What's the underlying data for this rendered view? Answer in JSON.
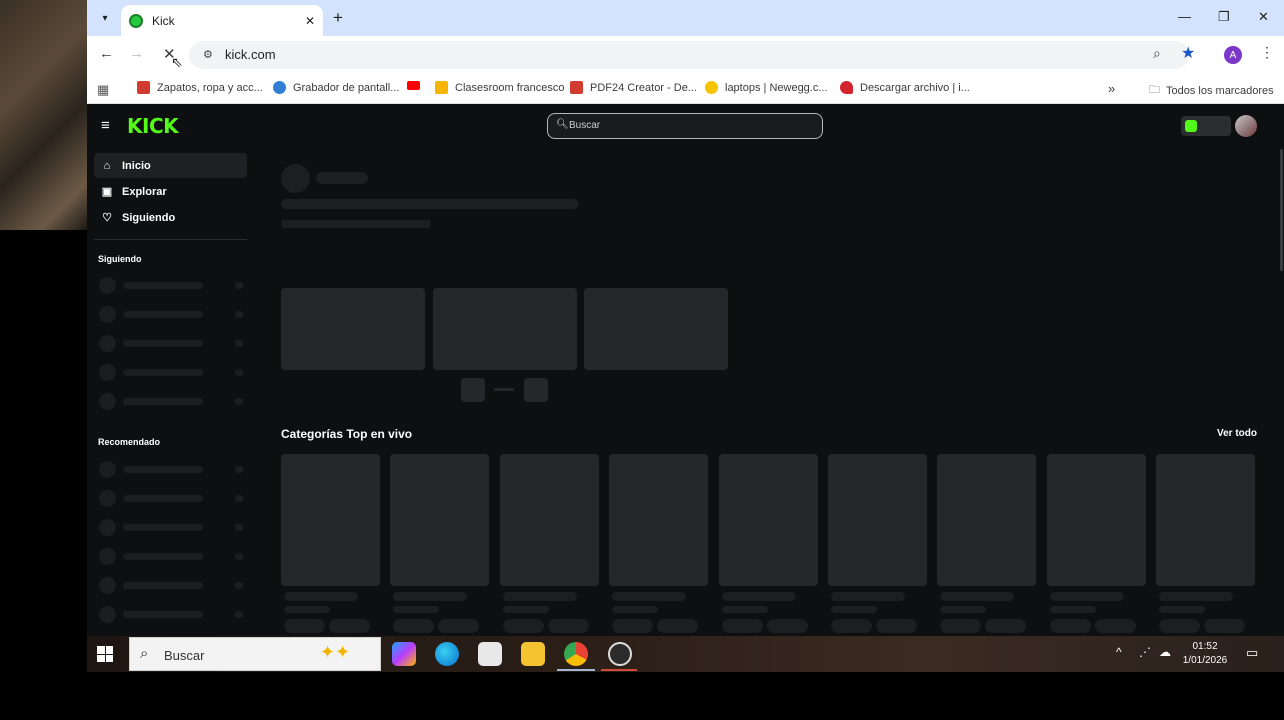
{
  "browser": {
    "tab_title": "Kick",
    "url": "kick.com",
    "avatar_letter": "A",
    "bookmarks": [
      {
        "label": "Zapatos, ropa y acc...",
        "color": "#d23b2f"
      },
      {
        "label": "Grabador de pantall...",
        "color": "#2f7fd2"
      },
      {
        "label": "",
        "color": "#ff0000"
      },
      {
        "label": "Clasesroom francesco",
        "color": "#f4b400"
      },
      {
        "label": "PDF24 Creator - De...",
        "color": "#d23b2f"
      },
      {
        "label": "laptops | Newegg.c...",
        "color": "#f4c400"
      },
      {
        "label": "Descargar archivo | i...",
        "color": "#d2232f"
      }
    ],
    "all_bookmarks": "Todos los marcadores"
  },
  "kick": {
    "logo": "KICK",
    "search_placeholder": "Buscar",
    "nav": [
      {
        "label": "Inicio",
        "icon": "home-icon"
      },
      {
        "label": "Explorar",
        "icon": "compass-icon"
      },
      {
        "label": "Siguiendo",
        "icon": "heart-icon"
      }
    ],
    "following_heading": "Siguiendo",
    "recommended_heading": "Recomendado",
    "categories_title": "Categorías Top en vivo",
    "see_all": "Ver todo",
    "brand_color": "#53fc18"
  },
  "taskbar": {
    "search_text": "Buscar",
    "time": "01:52",
    "date": "1/01/2026"
  }
}
